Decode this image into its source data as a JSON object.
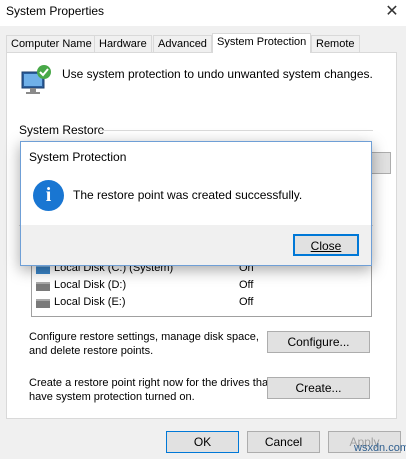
{
  "window": {
    "title": "System Properties"
  },
  "tabs": [
    {
      "label": "Computer Name"
    },
    {
      "label": "Hardware"
    },
    {
      "label": "Advanced"
    },
    {
      "label": "System Protection"
    },
    {
      "label": "Remote"
    }
  ],
  "intro": {
    "text": "Use system protection to undo unwanted system changes."
  },
  "system_restore": {
    "label": "System Restore"
  },
  "drives": [
    {
      "name": "Local Disk (C:) (System)",
      "protection": "On"
    },
    {
      "name": "Local Disk (D:)",
      "protection": "Off"
    },
    {
      "name": "Local Disk (E:)",
      "protection": "Off"
    }
  ],
  "configure": {
    "text_line1": "Configure restore settings, manage disk space,",
    "text_line2": "and delete restore points.",
    "button": "Configure..."
  },
  "create": {
    "text_line1": "Create a restore point right now for the drives that",
    "text_line2": "have system protection turned on.",
    "button": "Create..."
  },
  "footer": {
    "ok": "OK",
    "cancel": "Cancel",
    "apply": "Apply"
  },
  "dialog": {
    "title": "System Protection",
    "message": "The restore point was created successfully.",
    "close_button": "Close",
    "icon": "info-icon"
  },
  "watermark": "wsxdn.com",
  "colors": {
    "accent": "#0078d7",
    "info_icon": "#1976d2"
  }
}
